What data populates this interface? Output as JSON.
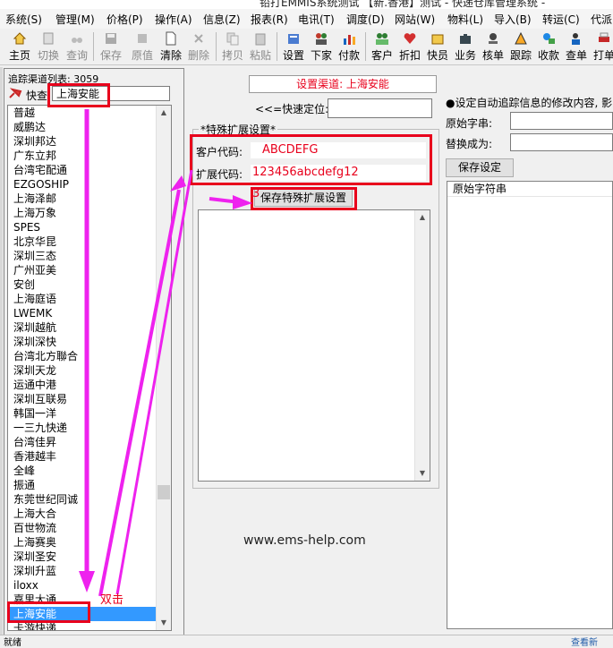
{
  "window": {
    "title": "铅打EMMIS系统测试 【新.香港】测试 - 快递仓库管理系统 -"
  },
  "menu": [
    "系统(S)",
    "管理(M)",
    "价格(P)",
    "操作(A)",
    "信息(Z)",
    "报表(R)",
    "电讯(T)",
    "调度(D)",
    "网站(W)",
    "物料(L)",
    "导入(B)",
    "转运(C)",
    "代派"
  ],
  "toolbar": {
    "home": "主页",
    "switch": "切换",
    "query": "查询",
    "save": "保存",
    "original": "原值",
    "clear": "清除",
    "delete": "删除",
    "copy": "拷贝",
    "paste": "粘贴",
    "settings": "设置",
    "download": "下家",
    "payment": "付款",
    "customer": "客户",
    "discount": "折扣",
    "express": "快员",
    "business": "业务",
    "verify": "核单",
    "track": "跟踪",
    "collect": "收款",
    "check": "查单",
    "print": "打单"
  },
  "left": {
    "list_label": "追踪渠道列表: 3059",
    "quick_label": "快查",
    "quick_value": "上海安能",
    "channels": [
      "普越",
      "威鹏达",
      "深圳邦达",
      "广东立邦",
      "台湾宅配通",
      "EZGOSHIP",
      "上海泽邮",
      "上海万象",
      "SPES",
      "北京华昆",
      "深圳三态",
      "广州亚美",
      "安创",
      "上海庭语",
      "LWEMK",
      "深圳越航",
      "深圳深快",
      "台湾北方聯合",
      "深圳天龙",
      "运通中港",
      "深圳互联易",
      "韩国一洋",
      "一三九快递",
      "台湾佳昇",
      "香港越丰",
      "全峰",
      "振通",
      "东莞世纪同诚",
      "上海大合",
      "百世物流",
      "上海赛奥",
      "深圳圣安",
      "深圳升蓝",
      "iloxx",
      "嘉里大通",
      "上海安能",
      "卡游快递"
    ],
    "selected_channel": "上海安能"
  },
  "middle": {
    "set_channel": "设置渠道: 上海安能",
    "quick_pos_label": "<<=快速定位:",
    "legend": "*特殊扩展设置*",
    "customer_code_label": "客户代码:",
    "customer_code_value": "ABCDEFG",
    "ext_code_label": "扩展代码:",
    "ext_code_value": "123456abcdefg12",
    "save_ext_button": "保存特殊扩展设置",
    "step_marker": "3"
  },
  "right": {
    "auto_track_note": "●设定自动追踪信息的修改内容, 影",
    "orig_str_label": "原始字串:",
    "replace_label": "替换成为:",
    "save_button": "保存设定",
    "column_header": "原始字符串"
  },
  "annotations": {
    "double_click": "双击",
    "watermark": "www.ems-help.com"
  },
  "status": {
    "left": "就绪",
    "right": "查看新"
  },
  "colors": {
    "accent_red": "#e8001c",
    "arrow_magenta": "#ee22ee",
    "selection_blue": "#3399ff"
  }
}
